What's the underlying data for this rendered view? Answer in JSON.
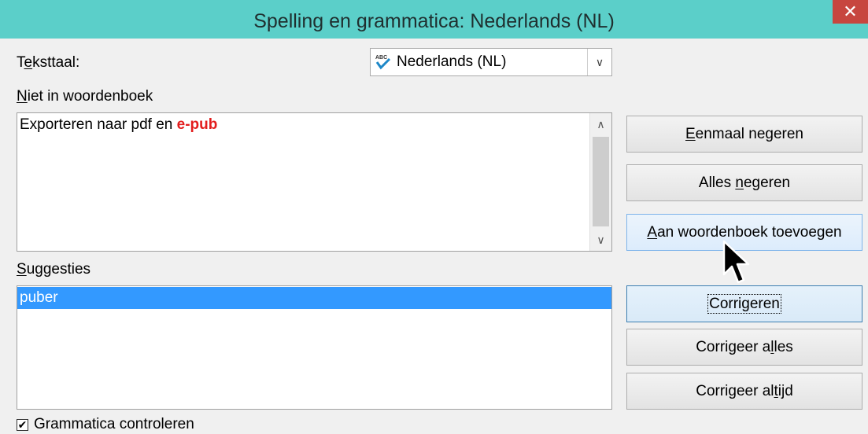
{
  "window": {
    "title": "Spelling en grammatica: Nederlands (NL)",
    "close_symbol": "✕"
  },
  "language": {
    "label_mnemonic": "e",
    "label_pre": "T",
    "label_post": "ksttaal:",
    "value": "Nederlands (NL)",
    "icon": "spellcheck-icon"
  },
  "not_in_dictionary": {
    "label_mnemonic": "N",
    "label_rest": "iet in woordenboek",
    "sentence_prefix": "Exporteren naar pdf en ",
    "error_word": "e-pub",
    "error_color": "#e31d1d"
  },
  "suggestions": {
    "label_mnemonic": "S",
    "label_rest": "uggesties",
    "items": [
      "puber"
    ],
    "selected_color": "#3399ff"
  },
  "buttons": {
    "ignore_once": {
      "mn": "E",
      "rest": "enmaal negeren"
    },
    "ignore_all": {
      "pre": "Alles ",
      "mn": "n",
      "rest": "egeren"
    },
    "add_dict": {
      "mn": "A",
      "rest": "an woordenboek toevoegen"
    },
    "correct": {
      "label": "Corrigeren"
    },
    "correct_all": {
      "pre": "Corrigeer a",
      "mn": "l",
      "rest": "les"
    },
    "correct_always": {
      "pre": "Corrigeer al",
      "mn": "t",
      "rest": "ijd"
    }
  },
  "grammar_check": {
    "checked": true,
    "check_mark": "✔",
    "label": "Grammatica controleren"
  },
  "colors": {
    "titlebar": "#5bcfc9",
    "close": "#c7463f"
  }
}
